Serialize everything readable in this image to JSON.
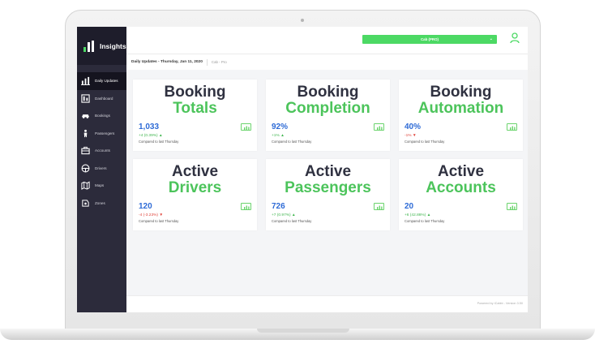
{
  "app": {
    "brand": "Insights"
  },
  "sidebar": {
    "items": [
      {
        "label": "Daily Updates",
        "icon": "bar-chart-icon",
        "active": true
      },
      {
        "label": "Dashboard",
        "icon": "dashboard-icon"
      },
      {
        "label": "Bookings",
        "icon": "car-icon"
      },
      {
        "label": "Passengers",
        "icon": "person-icon"
      },
      {
        "label": "Accounts",
        "icon": "briefcase-icon"
      },
      {
        "label": "Drivers",
        "icon": "steering-wheel-icon"
      },
      {
        "label": "Maps",
        "icon": "map-icon"
      },
      {
        "label": "Zones",
        "icon": "zone-icon"
      }
    ]
  },
  "topbar": {
    "select_value": "Cab (PRO)"
  },
  "subbar": {
    "title": "Daily Updates - Thursday, Jan 11, 2020",
    "subtitle": "Cab - Pro"
  },
  "cards": [
    {
      "line1": "Booking",
      "line2": "Totals",
      "value": "1,033",
      "delta": "+4 (0.39%) ▲",
      "trend": "up",
      "compare": "Compared to last Thursday"
    },
    {
      "line1": "Booking",
      "line2": "Completion",
      "value": "92%",
      "delta": "+1% ▲",
      "trend": "up",
      "compare": "Compared to last Thursday"
    },
    {
      "line1": "Booking",
      "line2": "Automation",
      "value": "40%",
      "delta": "-1% ▼",
      "trend": "down",
      "compare": "Compared to last Thursday"
    },
    {
      "line1": "Active",
      "line2": "Drivers",
      "value": "120",
      "delta": "-4 (-3.23%) ▼",
      "trend": "down",
      "compare": "Compared to last Thursday"
    },
    {
      "line1": "Active",
      "line2": "Passengers",
      "value": "726",
      "delta": "+7 (0.97%) ▲",
      "trend": "up",
      "compare": "Compared to last Thursday"
    },
    {
      "line1": "Active",
      "line2": "Accounts",
      "value": "20",
      "delta": "+6 (42.86%) ▲",
      "trend": "up",
      "compare": "Compared to last Thursday"
    }
  ],
  "footer": {
    "text": "Powered by iCabbi - Version 3.50"
  },
  "colors": {
    "accent_green": "#4cd964",
    "metric_blue": "#2e6bd6",
    "sidebar_bg": "#2c2b3b"
  }
}
